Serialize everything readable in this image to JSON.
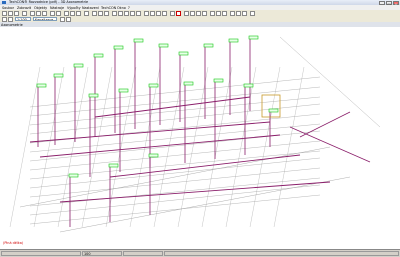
{
  "window": {
    "title": "TechCON® Rozvodnice (pdf) - 3D Axonometrie"
  },
  "menu": {
    "items": [
      "Soubor",
      "Zobrazit",
      "Objekty",
      "Nástroje",
      "Výpočty",
      "Nastavení",
      "TechCON",
      "Okno",
      "?"
    ]
  },
  "toolbar": {
    "scale_value": "1:100",
    "category_value": "Kanalizace"
  },
  "view": {
    "label": "Axonometrie"
  },
  "status": {
    "message": "(Plná délka)",
    "coords": "100"
  },
  "colors": {
    "pipe": "#8a1e6a",
    "tag": "#14c814",
    "construction": "#9a9a9a"
  }
}
